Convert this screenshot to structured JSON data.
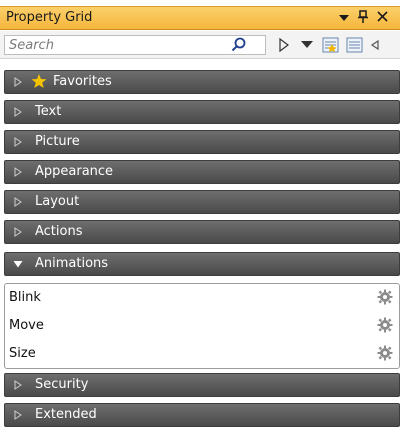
{
  "window": {
    "title": "Property Grid",
    "pin_glyph": "ᵖ",
    "close_glyph": "✕",
    "dropdown_glyph": "▾",
    "accent": "#f5b63c"
  },
  "toolbar": {
    "search_placeholder": "Search",
    "icons": [
      "search-icon",
      "expand-icon",
      "dropdown-icon",
      "categorized-icon",
      "list-icon"
    ]
  },
  "categories": [
    {
      "label": "Favorites",
      "expanded": false,
      "icon": "star-icon"
    },
    {
      "label": "Text",
      "expanded": false
    },
    {
      "label": "Picture",
      "expanded": false
    },
    {
      "label": "Appearance",
      "expanded": false
    },
    {
      "label": "Layout",
      "expanded": false
    },
    {
      "label": "Actions",
      "expanded": false
    },
    {
      "label": "Animations",
      "expanded": true
    },
    {
      "label": "Security",
      "expanded": false
    },
    {
      "label": "Extended",
      "expanded": false
    }
  ],
  "animations": {
    "properties": [
      {
        "label": "Blink",
        "icon": "gear-icon"
      },
      {
        "label": "Move",
        "icon": "gear-icon"
      },
      {
        "label": "Size",
        "icon": "gear-icon"
      }
    ]
  },
  "colors": {
    "category_bar": "#5a5a5a",
    "star": "#f5c400"
  }
}
